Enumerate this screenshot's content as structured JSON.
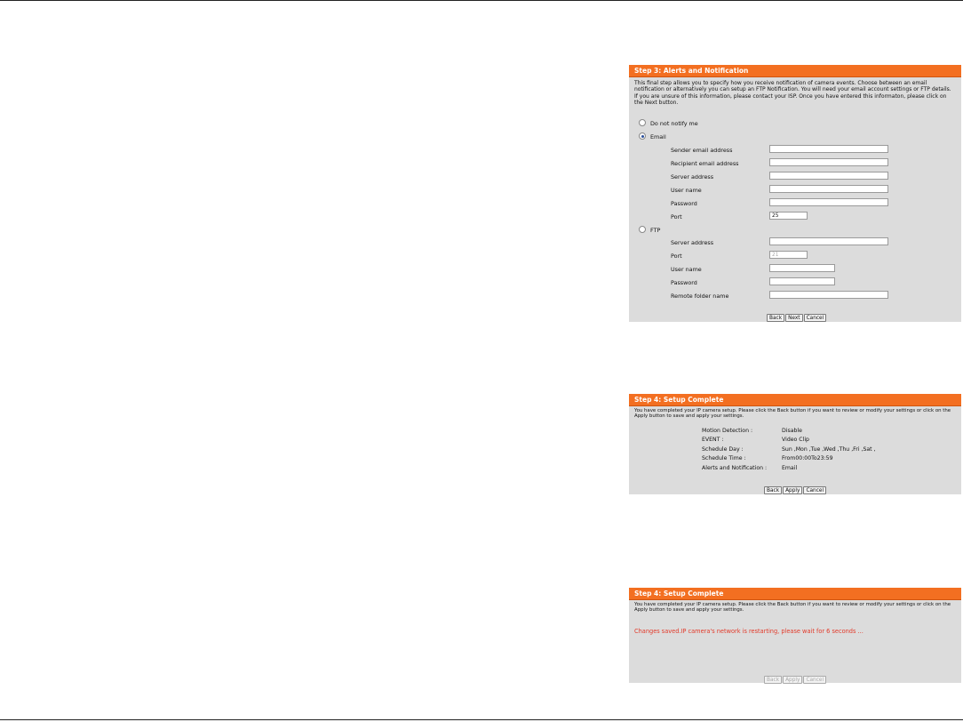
{
  "step3": {
    "title": "Step 3: Alerts and Notification",
    "description": "This final step allows you to specify how you receive notification of camera events. Choose between an email notification or alternatively you can setup an FTP Notification. You will need your email account settings or FTP details. If you are unsure of this information, please contact your ISP. Once you have entered this informaton, please click on the Next button.",
    "options": {
      "none": "Do not notify me",
      "email": "Email",
      "ftp": "FTP"
    },
    "selected_option": "email",
    "email_fields": {
      "sender": {
        "label": "Sender email address",
        "value": ""
      },
      "recipient": {
        "label": "Recipient email address",
        "value": ""
      },
      "server": {
        "label": "Server address",
        "value": ""
      },
      "user": {
        "label": "User name",
        "value": ""
      },
      "password": {
        "label": "Password",
        "value": ""
      },
      "port": {
        "label": "Port",
        "value": "25"
      }
    },
    "ftp_fields": {
      "server": {
        "label": "Server address",
        "value": ""
      },
      "port": {
        "label": "Port",
        "value": "21"
      },
      "user": {
        "label": "User name",
        "value": ""
      },
      "password": {
        "label": "Password",
        "value": ""
      },
      "folder": {
        "label": "Remote folder name",
        "value": ""
      }
    },
    "buttons": {
      "back": "Back",
      "next": "Next",
      "cancel": "Cancel"
    }
  },
  "step4a": {
    "title": "Step 4: Setup Complete",
    "description": "You have completed your IP camera setup. Please click the Back button if you want to review or modify your settings or click on the Apply button to save and apply your settings.",
    "summary": [
      {
        "label": "Motion Detection :",
        "value": "Disable"
      },
      {
        "label": "EVENT :",
        "value": "Video Clip"
      },
      {
        "label": "Schedule Day :",
        "value": "Sun ,Mon ,Tue ,Wed ,Thu ,Fri ,Sat ,"
      },
      {
        "label": "Schedule Time :",
        "value": "From00:00To23:59"
      },
      {
        "label": "Alerts and Notification :",
        "value": "Email"
      }
    ],
    "buttons": {
      "back": "Back",
      "apply": "Apply",
      "cancel": "Cancel"
    }
  },
  "step4b": {
    "title": "Step 4: Setup Complete",
    "description": "You have completed your IP camera setup. Please click the Back button if you want to review or modify your settings or click on the Apply button to save and apply your settings.",
    "status_message": "Changes saved.IP camera's network is restarting, please wait for 6 seconds ...",
    "buttons": {
      "back": "Back",
      "apply": "Apply",
      "cancel": "Cancel"
    }
  },
  "colors": {
    "header": "#f36f21",
    "panel": "#dcdcdc",
    "status": "#e23a2a"
  }
}
